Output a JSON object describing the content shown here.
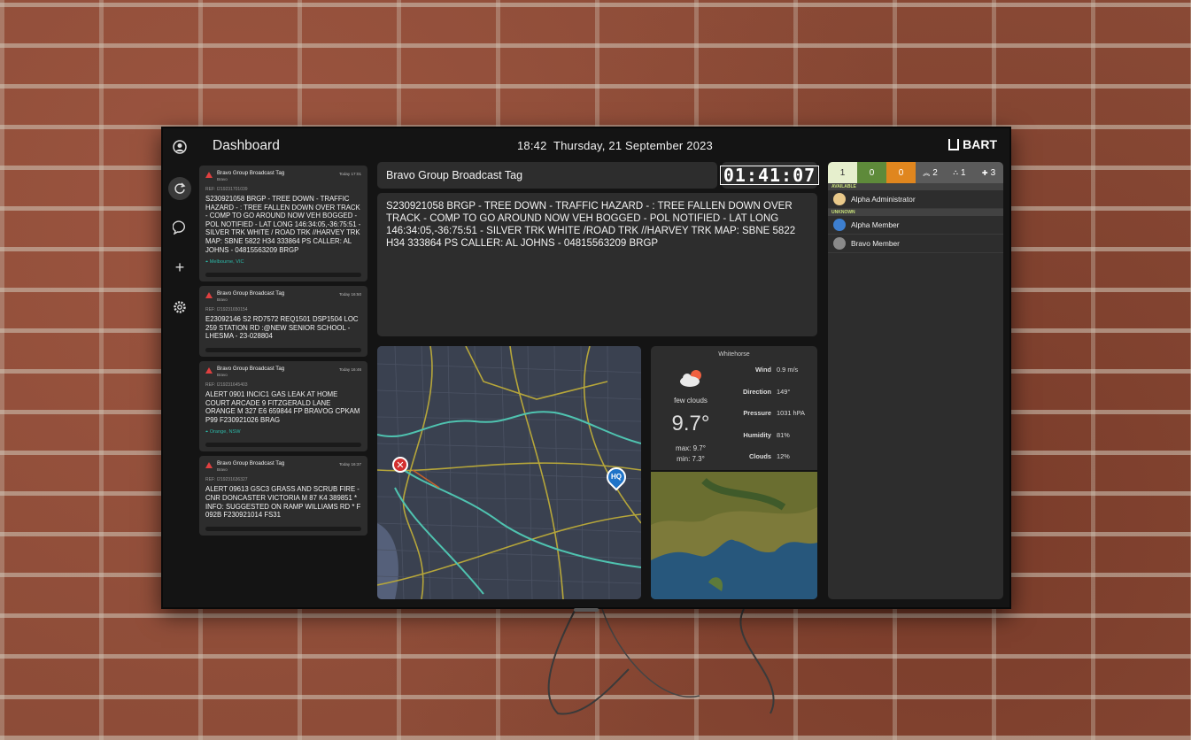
{
  "header": {
    "title": "Dashboard",
    "time": "18:42",
    "date": "Thursday, 21 September 2023",
    "brand": "BART"
  },
  "sidebar": {
    "icons": [
      "account-icon",
      "refresh-icon",
      "chat-icon",
      "plus-icon",
      "settings-icon"
    ]
  },
  "feed": [
    {
      "tag": "Bravo Group Broadcast Tag",
      "sub": "Bravo",
      "time": "Today 17:01",
      "ref": "REF: I219231701039",
      "message": "S230921058 BRGP - TREE DOWN - TRAFFIC HAZARD - : TREE FALLEN DOWN OVER TRACK - COMP TO GO AROUND NOW VEH BOGGED - POL NOTIFIED - LAT LONG 146:34:05,-36:75:51 - SILVER TRK WHITE / ROAD TRK //HARVEY TRK MAP: SBNE 5822 H34 333864 PS CALLER: AL JOHNS - 04815563209 BRGP",
      "location": "Melbourne, VIC"
    },
    {
      "tag": "Bravo Group Broadcast Tag",
      "sub": "Bravo",
      "time": "Today 16:50",
      "ref": "REF: I219231650154",
      "message": "E23092146 S2 RD7572 REQ1501 DSP1504 LOC 259 STATION RD :@NEW SENIOR SCHOOL -  LHESMA - 23-028804",
      "location": ""
    },
    {
      "tag": "Bravo Group Broadcast Tag",
      "sub": "Bravo",
      "time": "Today 16:46",
      "ref": "REF: I219231645403",
      "message": "ALERT 0901 INCIC1 GAS LEAK AT HOME COURT ARCADE 9 FITZGERALD LANE ORANGE M 327 E6 659844 FP BRAVOG CPKAM P99 F230921026 BRAG",
      "location": "Orange, NSW"
    },
    {
      "tag": "Bravo Group Broadcast Tag",
      "sub": "Bravo",
      "time": "Today 16:37",
      "ref": "REF: I219231636327",
      "message": "ALERT 09613 GSC3 GRASS AND SCRUB FIRE - CNR DONCASTER VICTORIA M 87 K4 389851 * INFO: SUGGESTED ON RAMP WILLIAMS RD * F 092B F230921014 FS31",
      "location": ""
    }
  ],
  "active": {
    "title": "Bravo Group Broadcast Tag",
    "elapsed": "01:41:07",
    "message": "S230921058 BRGP - TREE DOWN - TRAFFIC HAZARD - : TREE FALLEN DOWN OVER TRACK - COMP TO GO AROUND NOW VEH BOGGED - POL NOTIFIED - LAT LONG 146:34:05,-36:75:51 - SILVER TRK WHITE /ROAD TRK //HARVEY TRK MAP: SBNE 5822 H34 333864 PS CALLER: AL JOHNS - 04815563209 BRGP"
  },
  "map": {
    "hq_label": "HQ"
  },
  "weather": {
    "city": "Whitehorse",
    "description": "few clouds",
    "temp": "9.7°",
    "max": "max: 9.7°",
    "min": "min: 7.3°",
    "rows": [
      {
        "k": "Wind",
        "v": "0.9 m/s"
      },
      {
        "k": "Direction",
        "v": "149°"
      },
      {
        "k": "Pressure",
        "v": "1031 hPA"
      },
      {
        "k": "Humidity",
        "v": "81%"
      },
      {
        "k": "Clouds",
        "v": "12%"
      }
    ]
  },
  "availability": {
    "counts": [
      {
        "label": "1",
        "bg": "#e6efcd",
        "fg": "#333"
      },
      {
        "label": "0",
        "bg": "#5e8a3a",
        "fg": "#fff"
      },
      {
        "label": "0",
        "bg": "#e0861e",
        "fg": "#fff"
      },
      {
        "label": "2",
        "icon": "chevrons-up-icon",
        "bg": "#5b5b5b",
        "fg": "#fff"
      },
      {
        "label": "1",
        "icon": "group-icon",
        "bg": "#5b5b5b",
        "fg": "#fff"
      },
      {
        "label": "3",
        "icon": "medical-cross-icon",
        "bg": "#5b5b5b",
        "fg": "#fff"
      }
    ],
    "sections": [
      {
        "name": "AVAILABLE",
        "people": [
          {
            "name": "Alpha Administrator",
            "avatar": "#e9c98a"
          }
        ]
      },
      {
        "name": "UNKNOWN",
        "people": [
          {
            "name": "Alpha Member",
            "avatar": "#3d7fd0"
          },
          {
            "name": "Bravo Member",
            "avatar": "#8a8a8a"
          }
        ]
      }
    ]
  }
}
